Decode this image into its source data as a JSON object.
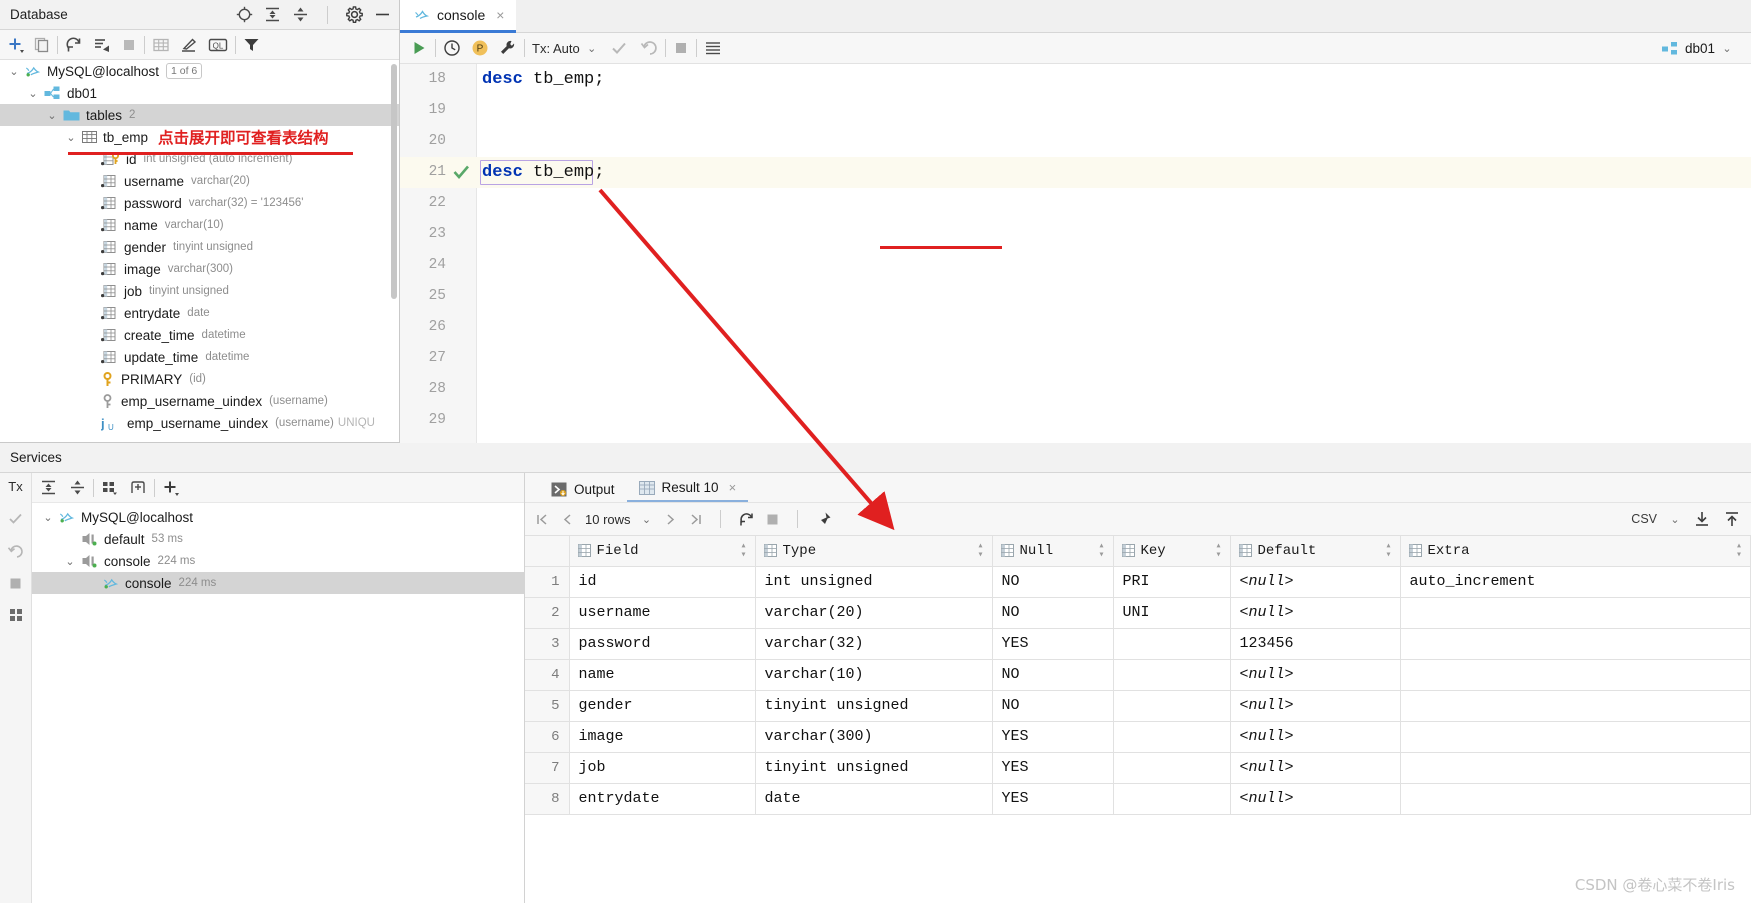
{
  "database_panel": {
    "title": "Database",
    "header_icons": [
      "locate-icon",
      "expand-all-icon",
      "collapse-all-icon",
      "settings-gear-icon",
      "hide-icon"
    ],
    "toolbar_icons": [
      "add-icon",
      "duplicate-icon",
      "refresh-icon",
      "sync-icon",
      "stop-icon",
      "table-editor-icon",
      "modify-icon",
      "query-console-icon",
      "filter-icon"
    ],
    "tree": [
      {
        "label": "MySQL@localhost",
        "meta": "",
        "badge": "1 of 6",
        "icon": "mysql-dolphin-icon",
        "indent": 0,
        "expanded": true
      },
      {
        "label": "db01",
        "meta": "",
        "badge": "",
        "icon": "schema-icon",
        "indent": 1,
        "expanded": true
      },
      {
        "label": "tables",
        "meta": "2",
        "badge": "",
        "icon": "folder-icon",
        "indent": 2,
        "expanded": true,
        "selected": true
      },
      {
        "label": "tb_emp",
        "meta": "",
        "badge": "",
        "icon": "table-icon",
        "indent": 3,
        "expanded": true,
        "annotation": "点击展开即可查看表结构"
      },
      {
        "label": "id",
        "meta": "int unsigned (auto increment)",
        "icon": "primary-key-column-icon",
        "indent": 4
      },
      {
        "label": "username",
        "meta": "varchar(20)",
        "icon": "column-icon",
        "indent": 4
      },
      {
        "label": "password",
        "meta": "varchar(32) = '123456'",
        "icon": "column-icon",
        "indent": 4
      },
      {
        "label": "name",
        "meta": "varchar(10)",
        "icon": "column-icon",
        "indent": 4
      },
      {
        "label": "gender",
        "meta": "tinyint unsigned",
        "icon": "column-icon",
        "indent": 4
      },
      {
        "label": "image",
        "meta": "varchar(300)",
        "icon": "column-icon",
        "indent": 4
      },
      {
        "label": "job",
        "meta": "tinyint unsigned",
        "icon": "column-icon",
        "indent": 4
      },
      {
        "label": "entrydate",
        "meta": "date",
        "icon": "column-icon",
        "indent": 4
      },
      {
        "label": "create_time",
        "meta": "datetime",
        "icon": "column-icon",
        "indent": 4
      },
      {
        "label": "update_time",
        "meta": "datetime",
        "icon": "column-icon",
        "indent": 4
      },
      {
        "label": "PRIMARY",
        "meta": "(id)",
        "icon": "key-icon",
        "indent": 4
      },
      {
        "label": "emp_username_uindex",
        "meta": "(username)",
        "icon": "index-key-icon",
        "indent": 4
      },
      {
        "label": "emp_username_uindex",
        "meta": "(username)",
        "meta2": "UNIQU",
        "icon": "unique-index-icon",
        "indent": 4
      }
    ]
  },
  "editor": {
    "tab": {
      "label": "console",
      "icon": "mysql-dolphin-icon",
      "close": "×"
    },
    "toolbar": {
      "run_icon": "run-play-icon",
      "history_icon": "history-clock-icon",
      "profile_icon": "profile-p-icon",
      "settings_icon": "wrench-icon",
      "tx_label": "Tx: Auto",
      "commit_icon": "commit-check-icon",
      "rollback_icon": "rollback-icon",
      "stop_icon": "stop-icon",
      "grid_icon": "data-grid-icon",
      "schema_label": "db01",
      "schema_icon": "schema-icon"
    },
    "lines": [
      {
        "num": "18",
        "code_keyword": "desc",
        "code_rest": " tb_emp;",
        "marker": ""
      },
      {
        "num": "19",
        "code_keyword": "",
        "code_rest": "",
        "marker": ""
      },
      {
        "num": "20",
        "code_keyword": "",
        "code_rest": "",
        "marker": ""
      },
      {
        "num": "21",
        "code_keyword": "desc",
        "code_rest": " tb_emp;",
        "marker": "success-check-icon",
        "current": true
      },
      {
        "num": "22",
        "code_keyword": "",
        "code_rest": "",
        "marker": ""
      },
      {
        "num": "23",
        "code_keyword": "",
        "code_rest": "",
        "marker": ""
      },
      {
        "num": "24",
        "code_keyword": "",
        "code_rest": "",
        "marker": ""
      },
      {
        "num": "25",
        "code_keyword": "",
        "code_rest": "",
        "marker": ""
      },
      {
        "num": "26",
        "code_keyword": "",
        "code_rest": "",
        "marker": ""
      },
      {
        "num": "27",
        "code_keyword": "",
        "code_rest": "",
        "marker": ""
      },
      {
        "num": "28",
        "code_keyword": "",
        "code_rest": "",
        "marker": ""
      },
      {
        "num": "29",
        "code_keyword": "",
        "code_rest": "",
        "marker": ""
      }
    ]
  },
  "services": {
    "title": "Services",
    "gutter_icons": [
      "tx-icon",
      "commit-check-icon",
      "rollback-icon",
      "stop-icon",
      "grid-icon"
    ],
    "toolbar_icons": [
      "expand-all-icon",
      "collapse-all-icon",
      "group-icon",
      "add-frame-icon",
      "add-icon"
    ],
    "tree": [
      {
        "label": "MySQL@localhost",
        "meta": "",
        "icon": "mysql-dolphin-icon",
        "indent": 0,
        "expanded": true
      },
      {
        "label": "default",
        "meta": "53 ms",
        "icon": "connection-icon",
        "indent": 1
      },
      {
        "label": "console",
        "meta": "224 ms",
        "icon": "connection-icon",
        "indent": 1,
        "expanded": true
      },
      {
        "label": "console",
        "meta": "224 ms",
        "icon": "mysql-dolphin-icon",
        "indent": 2,
        "selected": true
      }
    ]
  },
  "results": {
    "tabs": [
      {
        "label": "Output",
        "icon": "output-icon",
        "active": false,
        "closable": false
      },
      {
        "label": "Result 10",
        "icon": "table-grid-icon",
        "active": true,
        "closable": true,
        "close": "×"
      }
    ],
    "toolbar": {
      "first_icon": "first-page-icon",
      "prev_icon": "prev-page-icon",
      "rows_label": "10 rows",
      "rows_chevron": "chevron-down-icon",
      "next_icon": "next-page-icon",
      "last_icon": "last-page-icon",
      "reload_icon": "reload-icon",
      "stop_icon": "stop-icon",
      "pin_icon": "pin-icon",
      "export_format": "CSV",
      "download_icon": "download-icon",
      "upload_icon": "upload-icon"
    },
    "columns": [
      "Field",
      "Type",
      "Null",
      "Key",
      "Default",
      "Extra"
    ],
    "rows": [
      {
        "n": "1",
        "Field": "id",
        "Type": "int unsigned",
        "Null": "NO",
        "Key": "PRI",
        "Default": "<null>",
        "Extra": "auto_increment"
      },
      {
        "n": "2",
        "Field": "username",
        "Type": "varchar(20)",
        "Null": "NO",
        "Key": "UNI",
        "Default": "<null>",
        "Extra": ""
      },
      {
        "n": "3",
        "Field": "password",
        "Type": "varchar(32)",
        "Null": "YES",
        "Key": "",
        "Default": "123456",
        "Extra": ""
      },
      {
        "n": "4",
        "Field": "name",
        "Type": "varchar(10)",
        "Null": "NO",
        "Key": "",
        "Default": "<null>",
        "Extra": ""
      },
      {
        "n": "5",
        "Field": "gender",
        "Type": "tinyint unsigned",
        "Null": "NO",
        "Key": "",
        "Default": "<null>",
        "Extra": ""
      },
      {
        "n": "6",
        "Field": "image",
        "Type": "varchar(300)",
        "Null": "YES",
        "Key": "",
        "Default": "<null>",
        "Extra": ""
      },
      {
        "n": "7",
        "Field": "job",
        "Type": "tinyint unsigned",
        "Null": "YES",
        "Key": "",
        "Default": "<null>",
        "Extra": ""
      },
      {
        "n": "8",
        "Field": "entrydate",
        "Type": "date",
        "Null": "YES",
        "Key": "",
        "Default": "<null>",
        "Extra": ""
      }
    ]
  },
  "watermark": "CSDN @卷心菜不卷Iris",
  "colors": {
    "accent_blue": "#3a7ad5",
    "annotation_red": "#e02020",
    "keyword_blue": "#0033b3",
    "success_green": "#59a869",
    "icon_cyan": "#62b8de"
  }
}
